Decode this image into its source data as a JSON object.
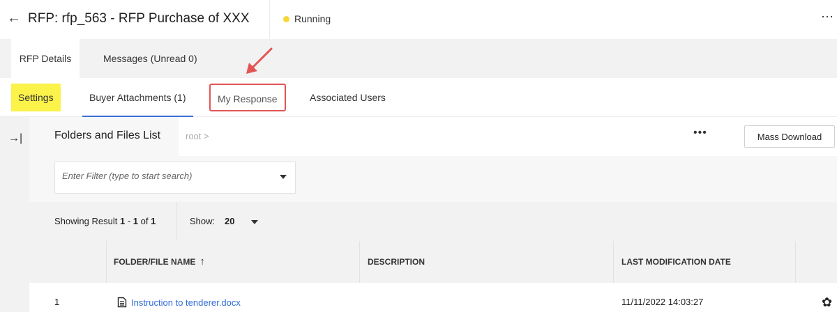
{
  "header": {
    "back_icon": "left-arrow-icon",
    "title": "RFP: rfp_563 - RFP Purchase of XXX",
    "status": "Running",
    "status_color": "#f5d63b",
    "more_icon": "more-horizontal-icon"
  },
  "primary_tabs": [
    {
      "label": "RFP Details",
      "active": true
    },
    {
      "label": "Messages (Unread 0)",
      "active": false
    }
  ],
  "secondary_tabs": [
    {
      "label": "Settings",
      "state": "highlighted"
    },
    {
      "label": "Buyer Attachments (1)",
      "state": "active"
    },
    {
      "label": "My Response",
      "state": "annotated"
    },
    {
      "label": "Associated Users",
      "state": "normal"
    }
  ],
  "annotation": {
    "color": "#e25555",
    "target": "My Response"
  },
  "folders": {
    "title": "Folders and Files List",
    "breadcrumb": "root >",
    "more_icon": "ellipsis-icon",
    "mass_download_label": "Mass Download",
    "collapse_icon": "collapse-panel-icon"
  },
  "filter": {
    "placeholder": "Enter Filter (type to start search)"
  },
  "results": {
    "prefix": "Showing Result",
    "range_start": "1",
    "range_sep": "-",
    "range_end": "1",
    "of_text": "of",
    "total": "1",
    "show_label": "Show:",
    "show_value": "20"
  },
  "table": {
    "columns": [
      "FOLDER/FILE NAME",
      "DESCRIPTION",
      "LAST MODIFICATION DATE"
    ],
    "sort_icon": "sort-ascending-icon",
    "rows": [
      {
        "index": "1",
        "name": "Instruction to tenderer.docx",
        "description": "",
        "modified": "11/11/2022 14:03:27",
        "action_icon": "gear-icon"
      }
    ]
  },
  "colors": {
    "accent": "#3b6fd8",
    "link": "#2f6bd6",
    "highlight": "#fbf24a",
    "panel_gray": "#f2f2f2"
  }
}
